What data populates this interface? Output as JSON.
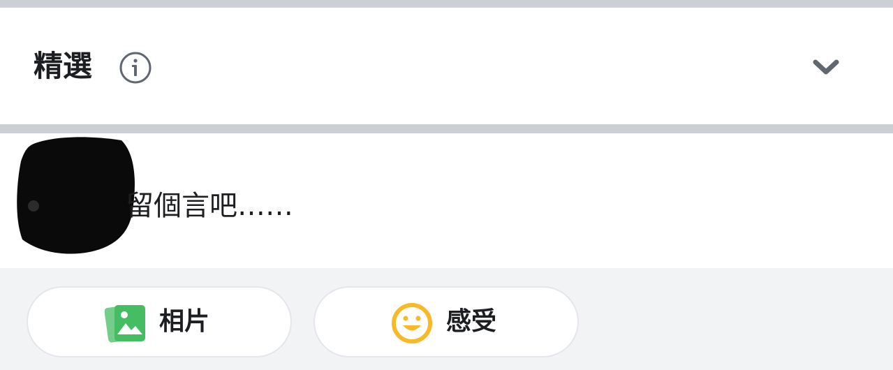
{
  "featured": {
    "title": "精選"
  },
  "composer": {
    "placeholder": "留個言吧……"
  },
  "actions": {
    "photo_label": "相片",
    "feeling_label": "感受"
  },
  "colors": {
    "divider": "#ccd0d5",
    "actions_background": "#f2f3f5",
    "photo_icon": "#45bd62",
    "feeling_icon": "#f7b928",
    "text": "#1c1e21",
    "icon_gray": "#606770"
  },
  "icons": {
    "info": "info-icon",
    "expand": "chevron-down-icon",
    "photo": "photo-icon",
    "feeling": "smiley-face-icon"
  }
}
